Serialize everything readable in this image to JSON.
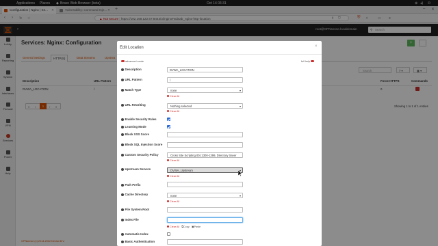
{
  "gnome": {
    "applications": "Applications",
    "places": "Places",
    "app_name": "Brave Web Browser (beta)",
    "datetime": "Oct 14  03:31"
  },
  "browser": {
    "tabs": [
      {
        "title": "Configuration | Nginx | Se..."
      },
      {
        "title": "Vulnerability: Command Inje..."
      }
    ],
    "new_tab": "+",
    "url_warning": "Not secure",
    "url": "https://192.168.122.67:8443/ui/nginx#subtab_nginx-http-location"
  },
  "opnsense": {
    "user": "root@OPNsense.localdomain",
    "search_placeholder": "Search"
  },
  "sidebar": {
    "items": [
      {
        "label": "Lobby"
      },
      {
        "label": "Reporting"
      },
      {
        "label": "System"
      },
      {
        "label": "Interfaces"
      },
      {
        "label": "Firewall"
      },
      {
        "label": "VPN"
      },
      {
        "label": "Services"
      },
      {
        "label": "Power"
      },
      {
        "label": "Help"
      }
    ]
  },
  "page": {
    "title": "Services: Nginx: Configuration",
    "tabs": [
      {
        "label": "General Settings"
      },
      {
        "label": "HTTP(S)"
      },
      {
        "label": "Data Streams"
      },
      {
        "label": "Upstrea"
      }
    ],
    "table_headers": {
      "description": "Description",
      "url_pattern": "URL Pattern",
      "force_https": "Force HTTPS",
      "commands": "Commands"
    },
    "row": {
      "description": "DVWA_LOCATION",
      "url_pattern": "/",
      "force_https": "0"
    },
    "search_placeholder": "Search",
    "page_size": "7",
    "pager": {
      "first": "«",
      "prev": "‹",
      "current": "1",
      "next": "›",
      "last": "»"
    },
    "showing": "Showing 1 to 1 of 1 entries",
    "footer": "OPNsense (c) 2014-2022 Deciso B.V."
  },
  "modal": {
    "title": "Edit Location",
    "advanced_mode": "advanced mode",
    "full_help": "full help",
    "clear_all": "Clear All",
    "copy": "Copy",
    "paste": "Paste",
    "fields": {
      "description": {
        "label": "Description",
        "value": "DVWA_LOCATION"
      },
      "url_pattern": {
        "label": "URL Pattern",
        "value": "/"
      },
      "match_type": {
        "label": "Match Type",
        "value": "none"
      },
      "url_rewriting": {
        "label": "URL Rewriting",
        "value": "Nothing selected"
      },
      "enable_security_rules": {
        "label": "Enable Security Rules",
        "checked": true
      },
      "learning_mode": {
        "label": "Learning Mode",
        "checked": true
      },
      "xss_score": {
        "label": "Block XSS Score",
        "value": ""
      },
      "sqli_score": {
        "label": "Block SQL Injection Score",
        "value": ""
      },
      "custom_policy": {
        "label": "Custom Security Policy",
        "value": "Cross Site Scripting IDs:1300-1399, Directory traver"
      },
      "upstream_servers": {
        "label": "Upstream Servers",
        "value": "DVWA_Upstream"
      },
      "path_prefix": {
        "label": "Path Prefix",
        "value": ""
      },
      "cache_directory": {
        "label": "Cache Directory",
        "value": "none"
      },
      "file_system_root": {
        "label": "File System Root",
        "value": ""
      },
      "index_file": {
        "label": "Index File",
        "value": ""
      },
      "automatic_index": {
        "label": "Automatic Index",
        "checked": false
      },
      "basic_auth": {
        "label": "Basic Authentication",
        "value": ""
      }
    }
  },
  "colors": {
    "accent": "#d94f00",
    "header": "#212121",
    "add_button": "#5cb85c",
    "primary": "#2a6ad7",
    "danger": "#c9302c"
  },
  "icons": [
    "application-menu-icon",
    "favicon-opnsense-icon",
    "close-icon",
    "back-arrow-icon",
    "forward-arrow-icon",
    "reload-icon",
    "bookmark-icon",
    "lock-warning-icon",
    "share-icon",
    "brave-shield-icon",
    "extensions-icon",
    "menu-icon",
    "opnsense-logo-icon",
    "user-icon",
    "search-icon",
    "add-icon",
    "columns-icon",
    "edit-icon",
    "info-icon",
    "dropdown-caret-icon"
  ]
}
